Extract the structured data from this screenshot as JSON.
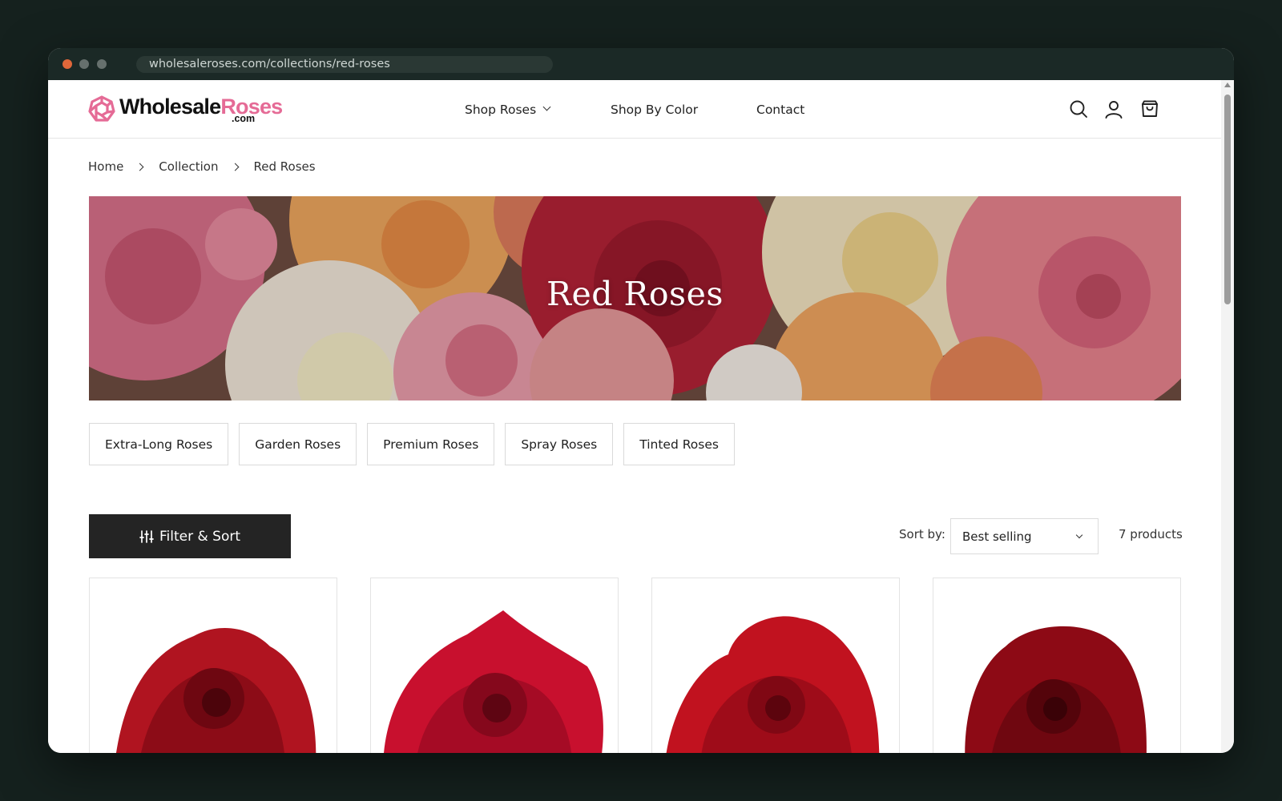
{
  "browser": {
    "url": "wholesaleroses.com/collections/red-roses"
  },
  "header": {
    "logo": {
      "word1": "Wholesale",
      "word2": "Roses",
      "suffix": ".com"
    },
    "nav": [
      {
        "label": "Shop Roses",
        "has_dropdown": true
      },
      {
        "label": "Shop By Color"
      },
      {
        "label": "Contact"
      }
    ],
    "icons": [
      "search-icon",
      "account-icon",
      "cart-icon"
    ]
  },
  "breadcrumb": [
    "Home",
    "Collection",
    "Red Roses"
  ],
  "hero": {
    "title": "Red Roses"
  },
  "categories": [
    "Extra-Long Roses",
    "Garden Roses",
    "Premium Roses",
    "Spray Roses",
    "Tinted Roses"
  ],
  "toolbar": {
    "filter_label": "Filter & Sort",
    "sort_label": "Sort by:",
    "sort_value": "Best selling",
    "count": "7 products"
  },
  "colors": {
    "brand_pink": "#e56b96",
    "dark": "#242424",
    "window_bg": "#15211e"
  },
  "products": [
    {
      "image": "red-rose-1"
    },
    {
      "image": "red-rose-2"
    },
    {
      "image": "red-rose-3"
    },
    {
      "image": "red-rose-4"
    }
  ]
}
